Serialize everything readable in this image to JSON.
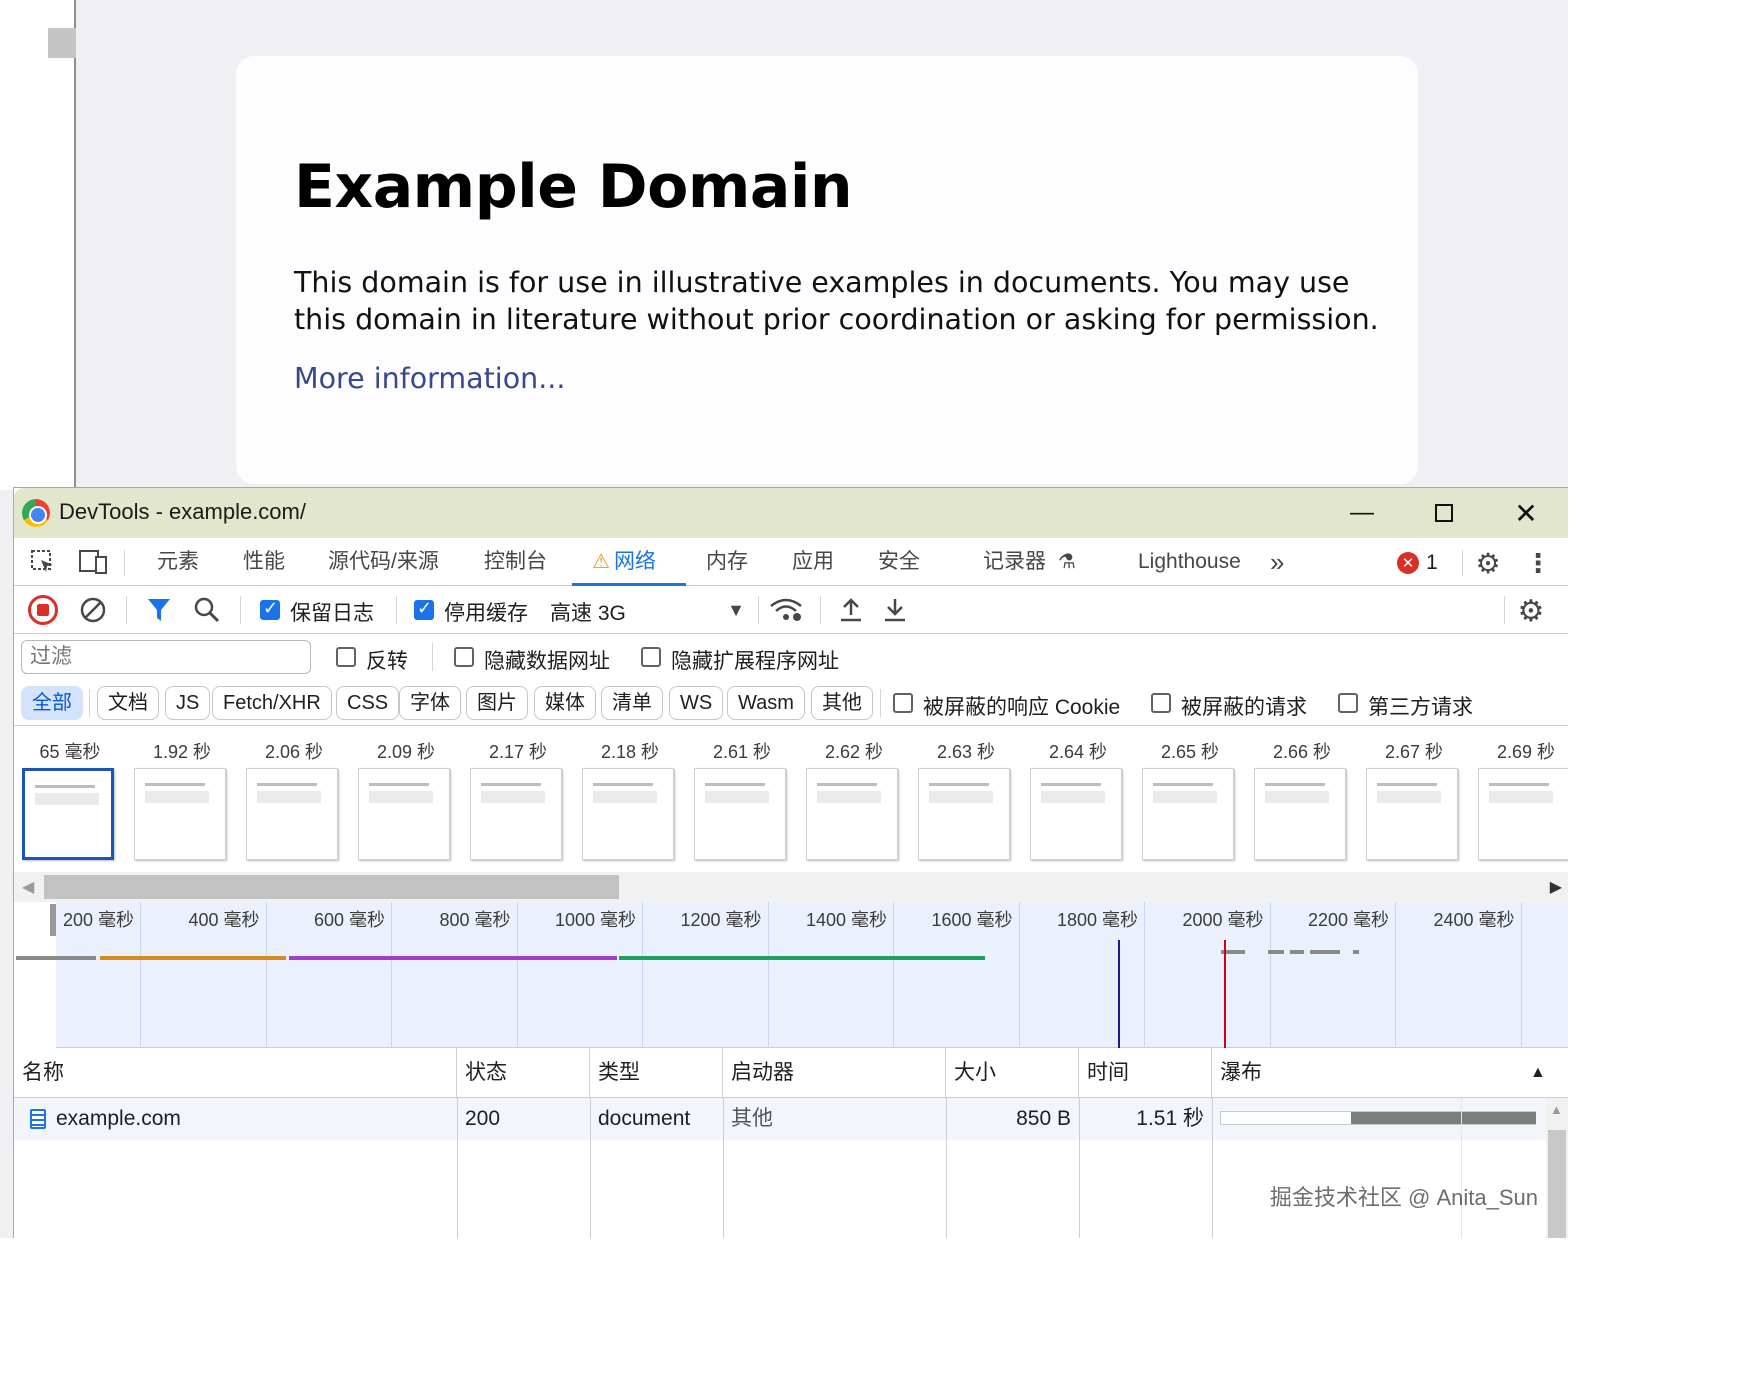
{
  "page": {
    "heading": "Example Domain",
    "paragraph": "This domain is for use in illustrative examples in documents. You may use this domain in literature without prior coordination or asking for permission.",
    "link": "More information..."
  },
  "window": {
    "title": "DevTools - example.com/",
    "minimize": "—",
    "maximize": "☐",
    "close": "✕"
  },
  "main_tabs": [
    {
      "label": "元素"
    },
    {
      "label": "性能"
    },
    {
      "label": "源代码/来源"
    },
    {
      "label": "控制台"
    },
    {
      "label": "网络",
      "active": true,
      "warning": "⚠"
    },
    {
      "label": "内存"
    },
    {
      "label": "应用"
    },
    {
      "label": "安全"
    },
    {
      "label": "记录器"
    },
    {
      "label": "Lighthouse"
    }
  ],
  "tab_overflow": "»",
  "error_count": "1",
  "toolbar": {
    "preserve_log": "保留日志",
    "disable_cache": "停用缓存",
    "throttle": "高速 3G",
    "preserve_log_checked": true,
    "disable_cache_checked": true
  },
  "filter": {
    "placeholder": "过滤",
    "invert": "反转",
    "hide_data_urls": "隐藏数据网址",
    "hide_ext_urls": "隐藏扩展程序网址"
  },
  "type_filters": [
    "全部",
    "文档",
    "JS",
    "Fetch/XHR",
    "CSS",
    "字体",
    "图片",
    "媒体",
    "清单",
    "WS",
    "Wasm",
    "其他"
  ],
  "extra_filters": [
    "被屏蔽的响应 Cookie",
    "被屏蔽的请求",
    "第三方请求"
  ],
  "filmstrip": {
    "times": [
      "65 毫秒",
      "1.92 秒",
      "2.06 秒",
      "2.09 秒",
      "2.17 秒",
      "2.18 秒",
      "2.61 秒",
      "2.62 秒",
      "2.63 秒",
      "2.64 秒",
      "2.65 秒",
      "2.66 秒",
      "2.67 秒",
      "2.69 秒"
    ],
    "selected_index": 0
  },
  "overview": {
    "ticks": [
      "200 毫秒",
      "400 毫秒",
      "600 毫秒",
      "800 毫秒",
      "1000 毫秒",
      "1200 毫秒",
      "1400 毫秒",
      "1600 毫秒",
      "1800 毫秒",
      "2000 毫秒",
      "2200 毫秒",
      "2400 毫秒"
    ],
    "dom_content_loaded_color": "#1a1a8c",
    "load_color": "#d0021b"
  },
  "table": {
    "headers": [
      "名称",
      "状态",
      "类型",
      "启动器",
      "大小",
      "时间",
      "瀑布"
    ],
    "rows": [
      {
        "name": "example.com",
        "status": "200",
        "type": "document",
        "initiator": "其他",
        "size": "850 B",
        "time": "1.51 秒"
      }
    ]
  },
  "watermark": "掘金技术社区 @ Anita_Sun",
  "colors": {
    "accent": "#1a73e8",
    "error": "#d93025",
    "warning": "#f29900"
  }
}
